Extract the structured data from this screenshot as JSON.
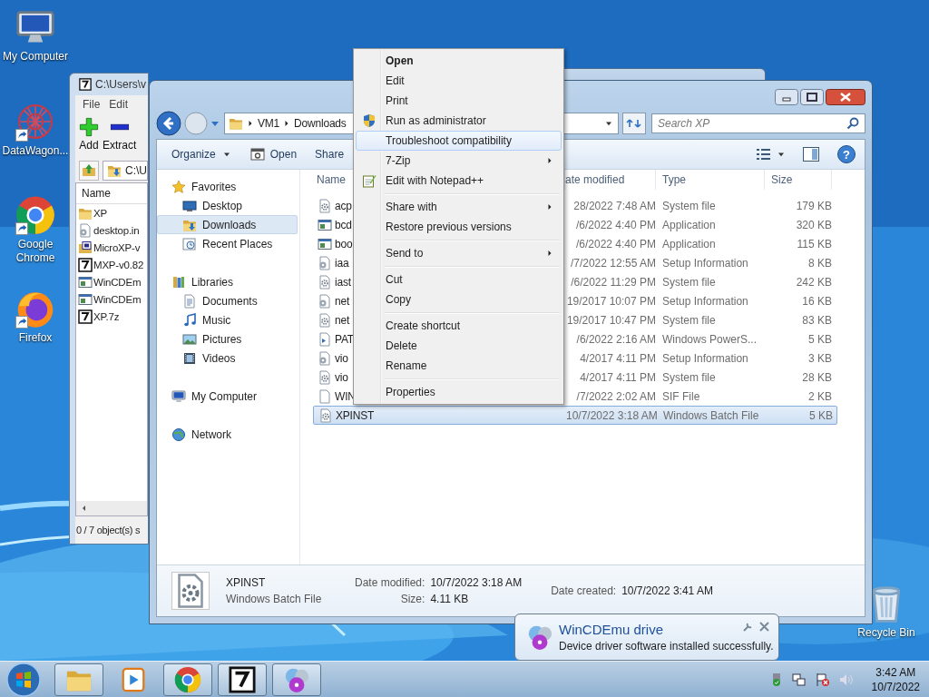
{
  "desktop_icons": [
    {
      "label": "My Computer",
      "kind": "computer",
      "shortcut": false
    },
    {
      "label": "DataWagon...",
      "kind": "datawagon",
      "shortcut": true
    },
    {
      "label": "Google Chrome",
      "kind": "chrome",
      "shortcut": true
    },
    {
      "label": "Firefox",
      "kind": "firefox",
      "shortcut": true
    }
  ],
  "recycle_bin": {
    "label": "Recycle Bin"
  },
  "sevenzip_window": {
    "title": "C:\\Users\\v",
    "menu": [
      "File",
      "Edit"
    ],
    "toolbar": [
      {
        "label": "Add",
        "kind": "add"
      },
      {
        "label": "Extract",
        "kind": "extract"
      }
    ],
    "path": "C:\\U",
    "column": "Name",
    "files": [
      {
        "name": "XP",
        "kind": "folder"
      },
      {
        "name": "desktop.in",
        "kind": "ini"
      },
      {
        "name": "MicroXP-v",
        "kind": "iso"
      },
      {
        "name": "MXP-v0.82",
        "kind": "archive"
      },
      {
        "name": "WinCDEm",
        "kind": "app"
      },
      {
        "name": "WinCDEm",
        "kind": "app"
      },
      {
        "name": "XP.7z",
        "kind": "archive"
      }
    ],
    "status": "0 / 7 object(s) s"
  },
  "explorer": {
    "breadcrumb": [
      "VM1",
      "Downloads"
    ],
    "search": {
      "placeholder": "Search XP"
    },
    "toolbar": [
      {
        "label": "Organize",
        "kind": "dropdown"
      },
      {
        "label": "Open",
        "kind": "open"
      },
      {
        "label": "Share",
        "kind": "plain"
      }
    ],
    "help": "?",
    "nav": [
      {
        "label": "Favorites",
        "kind": "star",
        "selected": false,
        "children": [
          {
            "label": "Desktop",
            "kind": "desktop",
            "selected": false
          },
          {
            "label": "Downloads",
            "kind": "downloads",
            "selected": true
          },
          {
            "label": "Recent Places",
            "kind": "recent",
            "selected": false
          }
        ]
      },
      {
        "label": "Libraries",
        "kind": "library",
        "selected": false,
        "children": [
          {
            "label": "Documents",
            "kind": "documents",
            "selected": false
          },
          {
            "label": "Music",
            "kind": "music",
            "selected": false
          },
          {
            "label": "Pictures",
            "kind": "pictures",
            "selected": false
          },
          {
            "label": "Videos",
            "kind": "videos",
            "selected": false
          }
        ]
      },
      {
        "label": "My Computer",
        "kind": "computer",
        "selected": false
      },
      {
        "label": "Network",
        "kind": "network",
        "selected": false
      }
    ],
    "columns": [
      "Name",
      "ate modified",
      "Type",
      "Size"
    ],
    "rows": [
      {
        "name": "acp",
        "date": "28/2022 7:48 AM",
        "type": "System file",
        "size": "179 KB",
        "kind": "sys",
        "selected": false
      },
      {
        "name": "bcd",
        "date": "/6/2022 4:40 PM",
        "type": "Application",
        "size": "320 KB",
        "kind": "app",
        "selected": false
      },
      {
        "name": "boo",
        "date": "/6/2022 4:40 PM",
        "type": "Application",
        "size": "115 KB",
        "kind": "app",
        "selected": false
      },
      {
        "name": "iaa",
        "date": "/7/2022 12:55 AM",
        "type": "Setup Information",
        "size": "8 KB",
        "kind": "inf",
        "selected": false
      },
      {
        "name": "iast",
        "date": "/6/2022 11:29 PM",
        "type": "System file",
        "size": "242 KB",
        "kind": "sys",
        "selected": false
      },
      {
        "name": "net",
        "date": "19/2017 10:07 PM",
        "type": "Setup Information",
        "size": "16 KB",
        "kind": "inf",
        "selected": false
      },
      {
        "name": "net",
        "date": "19/2017 10:47 PM",
        "type": "System file",
        "size": "83 KB",
        "kind": "sys",
        "selected": false
      },
      {
        "name": "PAT",
        "date": "/6/2022 2:16 AM",
        "type": "Windows PowerS...",
        "size": "5 KB",
        "kind": "script",
        "selected": false
      },
      {
        "name": "vio",
        "date": "4/2017 4:11 PM",
        "type": "Setup Information",
        "size": "3 KB",
        "kind": "inf",
        "selected": false
      },
      {
        "name": "vio",
        "date": "4/2017 4:11 PM",
        "type": "System file",
        "size": "28 KB",
        "kind": "sys",
        "selected": false
      },
      {
        "name": "WIN",
        "date": "/7/2022 2:02 AM",
        "type": "SIF File",
        "size": "2 KB",
        "kind": "blank",
        "selected": false
      },
      {
        "name": "XPINST",
        "date": "10/7/2022 3:18 AM",
        "type": "Windows Batch File",
        "size": "5 KB",
        "kind": "sys",
        "selected": true
      }
    ],
    "details": {
      "name": "XPINST",
      "type": "Windows Batch File",
      "groups": [
        [
          {
            "label": "Date modified:",
            "value": "10/7/2022 3:18 AM"
          },
          {
            "label": "Size:",
            "value": "4.11 KB"
          }
        ],
        [
          {
            "label": "Date created:",
            "value": "10/7/2022 3:41 AM"
          }
        ]
      ]
    }
  },
  "context_menu": [
    {
      "kind": "plain",
      "label": "Open",
      "bold": true,
      "selected": false
    },
    {
      "kind": "plain",
      "label": "Edit",
      "selected": false
    },
    {
      "kind": "plain",
      "label": "Print",
      "selected": false
    },
    {
      "kind": "shield",
      "label": "Run as administrator",
      "selected": false
    },
    {
      "kind": "plain",
      "label": "Troubleshoot compatibility",
      "selected": true
    },
    {
      "kind": "plain",
      "label": "7-Zip",
      "submenu": true,
      "selected": false
    },
    {
      "kind": "notepad",
      "label": "Edit with Notepad++",
      "selected": false
    },
    {
      "kind": "separator"
    },
    {
      "kind": "plain",
      "label": "Share with",
      "submenu": true,
      "selected": false
    },
    {
      "kind": "plain",
      "label": "Restore previous versions",
      "selected": false
    },
    {
      "kind": "separator"
    },
    {
      "kind": "plain",
      "label": "Send to",
      "submenu": true,
      "selected": false
    },
    {
      "kind": "separator"
    },
    {
      "kind": "plain",
      "label": "Cut",
      "selected": false
    },
    {
      "kind": "plain",
      "label": "Copy",
      "selected": false
    },
    {
      "kind": "separator"
    },
    {
      "kind": "plain",
      "label": "Create shortcut",
      "selected": false
    },
    {
      "kind": "plain",
      "label": "Delete",
      "selected": false
    },
    {
      "kind": "plain",
      "label": "Rename",
      "selected": false
    },
    {
      "kind": "separator"
    },
    {
      "kind": "plain",
      "label": "Properties",
      "selected": false
    }
  ],
  "notification": {
    "title": "WinCDEmu drive",
    "message": "Device driver software installed successfully."
  },
  "taskbar": {
    "apps": [
      {
        "kind": "folder",
        "running": true
      },
      {
        "kind": "media",
        "running": false
      },
      {
        "kind": "chrome",
        "running": true
      },
      {
        "kind": "archive",
        "running": true
      },
      {
        "kind": "disc",
        "running": true
      }
    ],
    "time": "3:42 AM",
    "date": "10/7/2022"
  }
}
